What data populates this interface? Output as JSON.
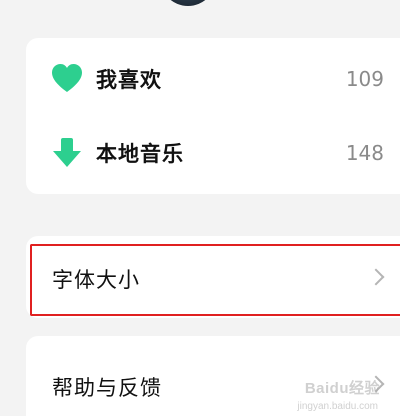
{
  "music_section": {
    "items": [
      {
        "label": "我喜欢",
        "count": "109",
        "icon": "heart-icon",
        "color": "#2dcf8f"
      },
      {
        "label": "本地音乐",
        "count": "148",
        "icon": "download-arrow-icon",
        "color": "#2dcf8f"
      }
    ]
  },
  "settings": {
    "font_size_label": "字体大小",
    "help_label": "帮助与反馈"
  },
  "watermark": {
    "brand": "Baidu经验",
    "url": "jingyan.baidu.com"
  },
  "colors": {
    "accent": "#2dcf8f",
    "highlight_border": "#e02020",
    "background": "#f3f3f3"
  }
}
